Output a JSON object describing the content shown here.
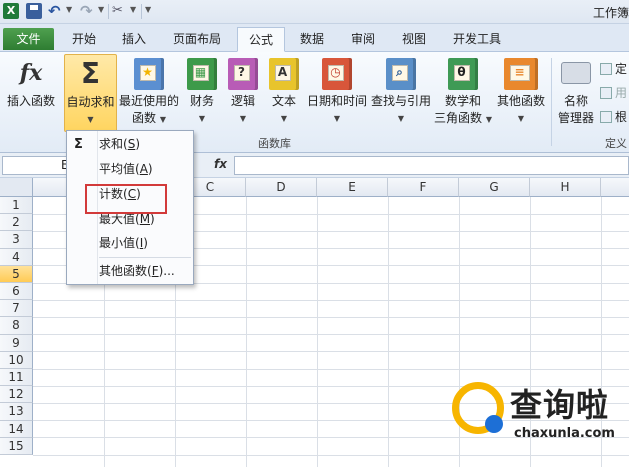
{
  "window": {
    "title": "工作簿"
  },
  "qat": {
    "logo": "X"
  },
  "tabs": [
    "文件",
    "开始",
    "插入",
    "页面布局",
    "公式",
    "数据",
    "审阅",
    "视图",
    "开发工具"
  ],
  "ribbon": {
    "insert_function": "插入函数",
    "autosum_line1": "自动求和",
    "recent_line1": "最近使用的",
    "recent_line2": "函数",
    "financial": "财务",
    "logical": "逻辑",
    "text": "文本",
    "datetime": "日期和时间",
    "lookup": "查找与引用",
    "math_line1": "数学和",
    "math_line2": "三角函数",
    "other": "其他函数",
    "name_mgr_line1": "名称",
    "name_mgr_line2": "管理器",
    "group_library": "函数库",
    "group_defined": "定义",
    "define_name": "定",
    "use_in_formula": "用",
    "create_from_sel": "根"
  },
  "formula_bar": {
    "name_box": "E",
    "fx": "fx"
  },
  "columns": [
    "C",
    "D",
    "E",
    "F",
    "G",
    "H"
  ],
  "rows": [
    "1",
    "2",
    "3",
    "4",
    "5",
    "6",
    "7",
    "8",
    "9",
    "10",
    "11",
    "12",
    "13",
    "14",
    "15"
  ],
  "autosum_menu": {
    "items": [
      {
        "label": "求和(",
        "key": "S",
        "end": ")"
      },
      {
        "label": "平均值(",
        "key": "A",
        "end": ")"
      },
      {
        "label": "计数(",
        "key": "C",
        "end": ")"
      },
      {
        "label": "最大值(",
        "key": "M",
        "end": ")"
      },
      {
        "label": "最小值(",
        "key": "I",
        "end": ")"
      },
      {
        "label": "其他函数(",
        "key": "F",
        "end": ")..."
      }
    ]
  },
  "watermark": {
    "brand": "查询啦",
    "url": "chaxunla.com"
  }
}
